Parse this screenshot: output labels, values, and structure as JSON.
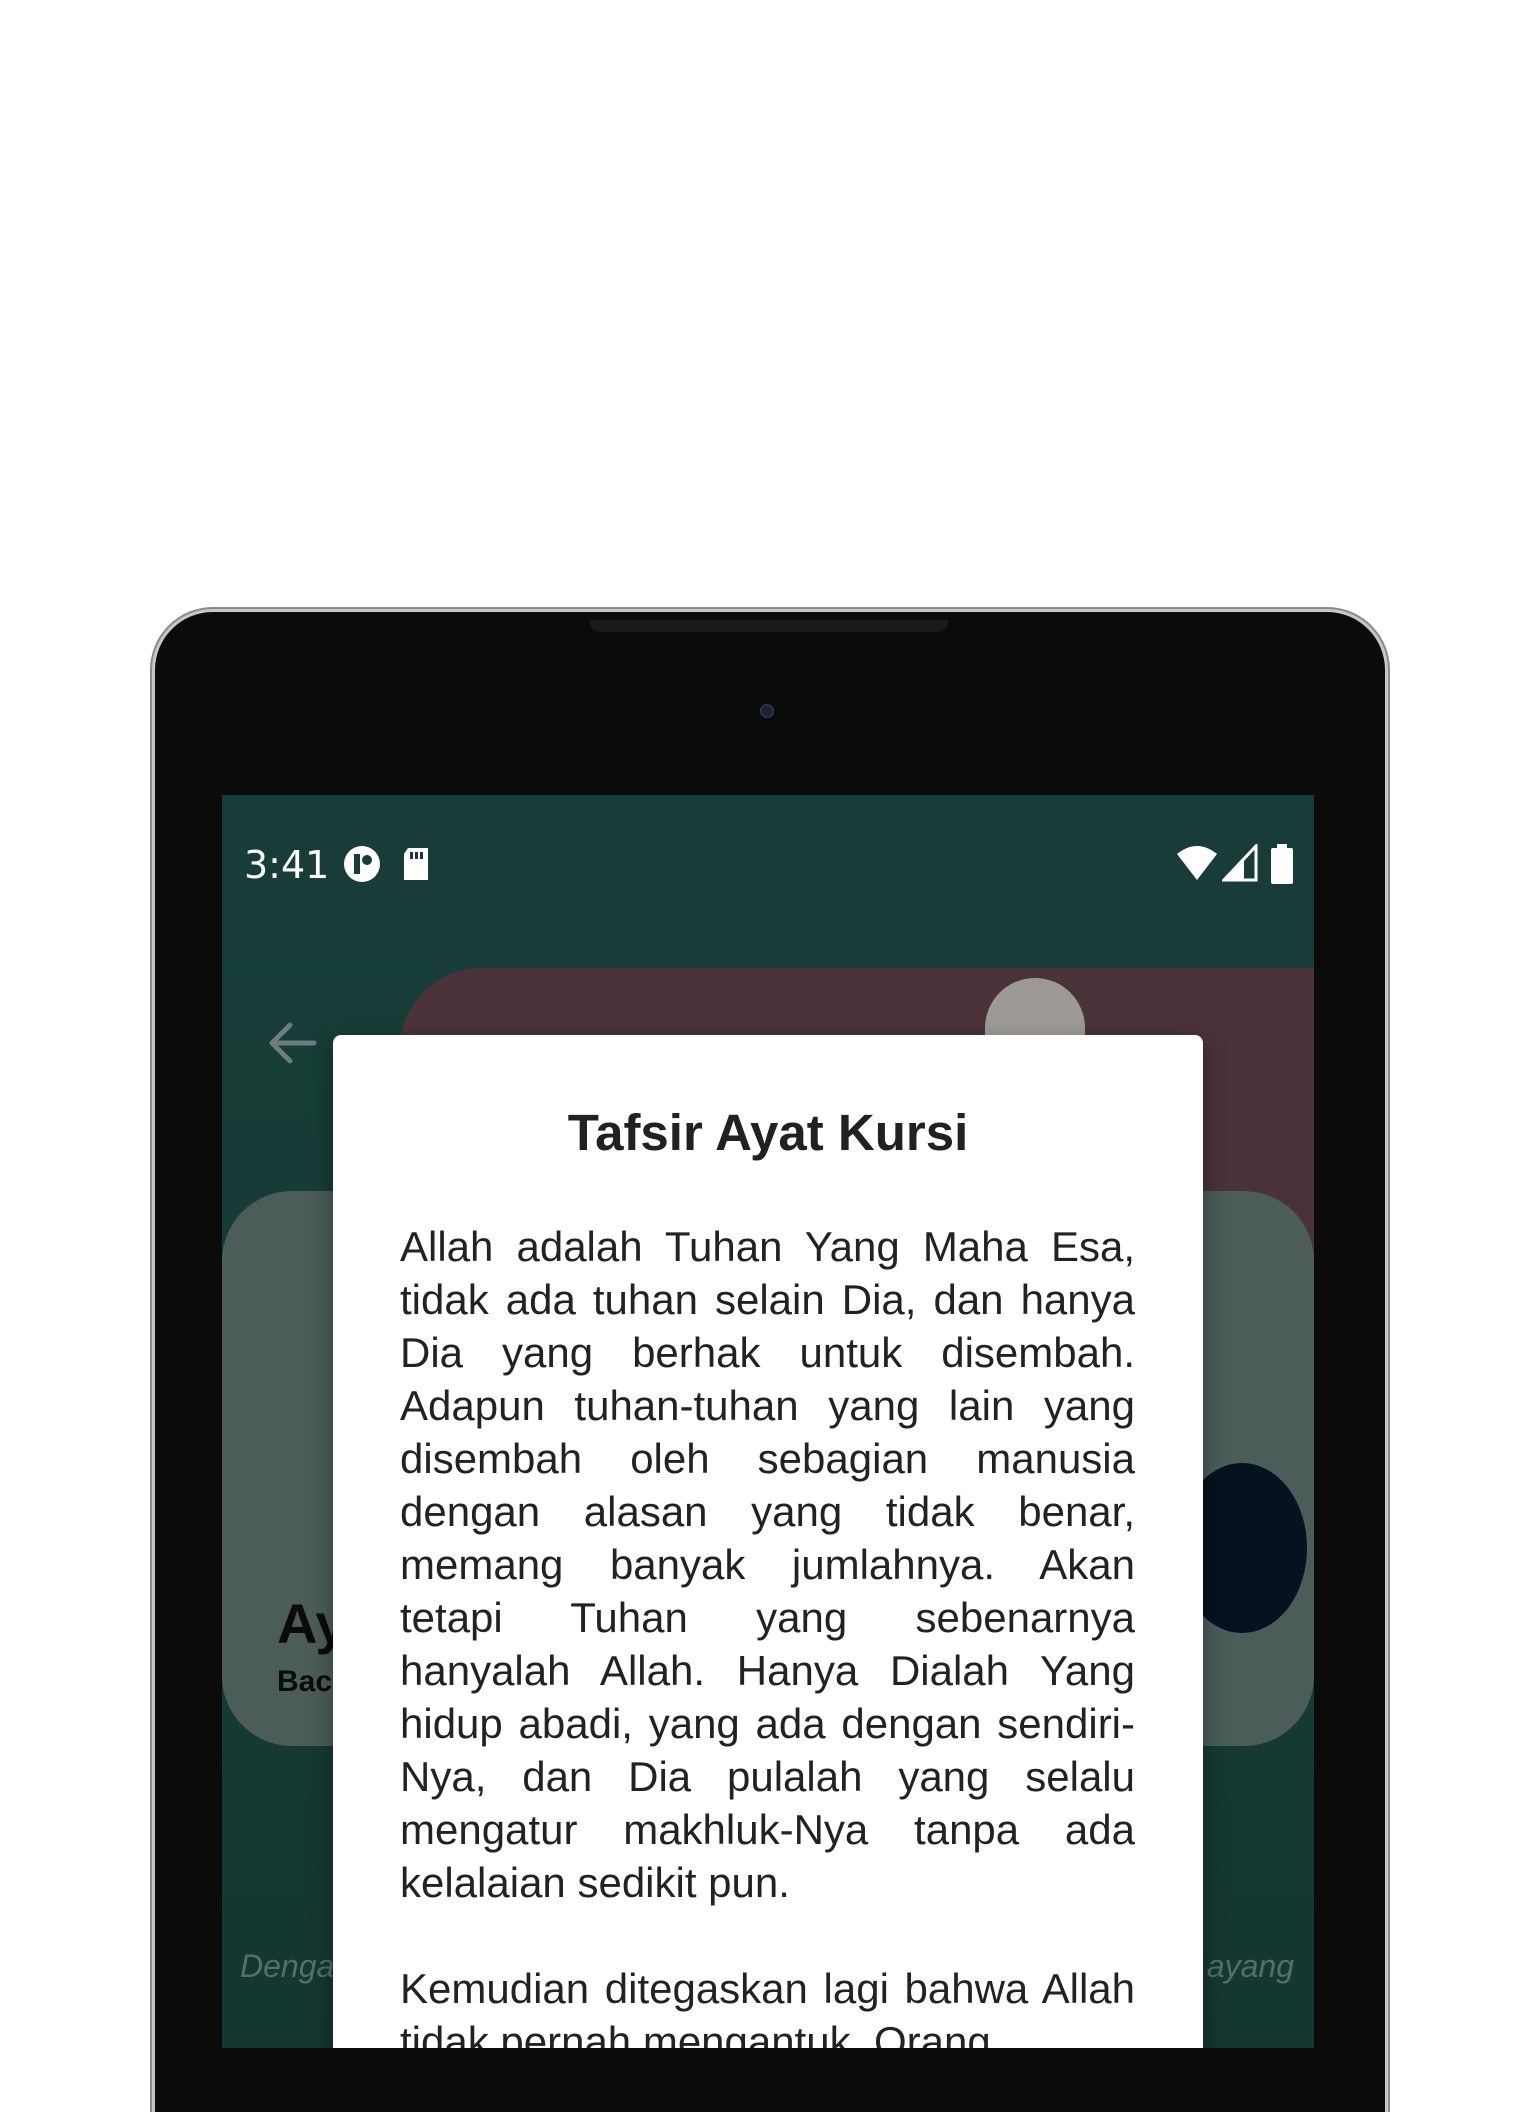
{
  "status_bar": {
    "time": "3:41",
    "left_icons": [
      "pocket-app-icon",
      "sd-card-icon"
    ],
    "right_icons": [
      "wifi-icon",
      "cell-signal-icon",
      "battery-icon"
    ]
  },
  "app": {
    "back_icon": "arrow-back-icon",
    "card_title": "Ay",
    "card_subtitle": "Bac",
    "footer_left": "Denga",
    "footer_right": "ayang"
  },
  "dialog": {
    "title": "Tafsir Ayat Kursi",
    "paragraphs": [
      "Allah adalah Tuhan Yang Maha Esa, tidak ada tuhan selain Dia, dan hanya Dia yang berhak untuk disembah. Adapun tuhan-tuhan yang lain yang disembah oleh sebagian manusia dengan alasan yang tidak benar, memang banyak jumlahnya. Akan tetapi Tuhan yang sebenarnya hanyalah Allah. Hanya Dialah Yang hidup abadi, yang ada dengan sendiri-Nya, dan Dia pulalah yang selalu mengatur makhluk-Nya tanpa ada kelalaian sedikit pun.",
      "Kemudian ditegaskan lagi bahwa Allah tidak pernah mengantuk. Orang"
    ]
  },
  "colors": {
    "status_bar": "#183d39",
    "app_background": "#1f5149",
    "banner": "#6e4a55",
    "card": "#6f8883",
    "dialog": "#ffffff"
  }
}
